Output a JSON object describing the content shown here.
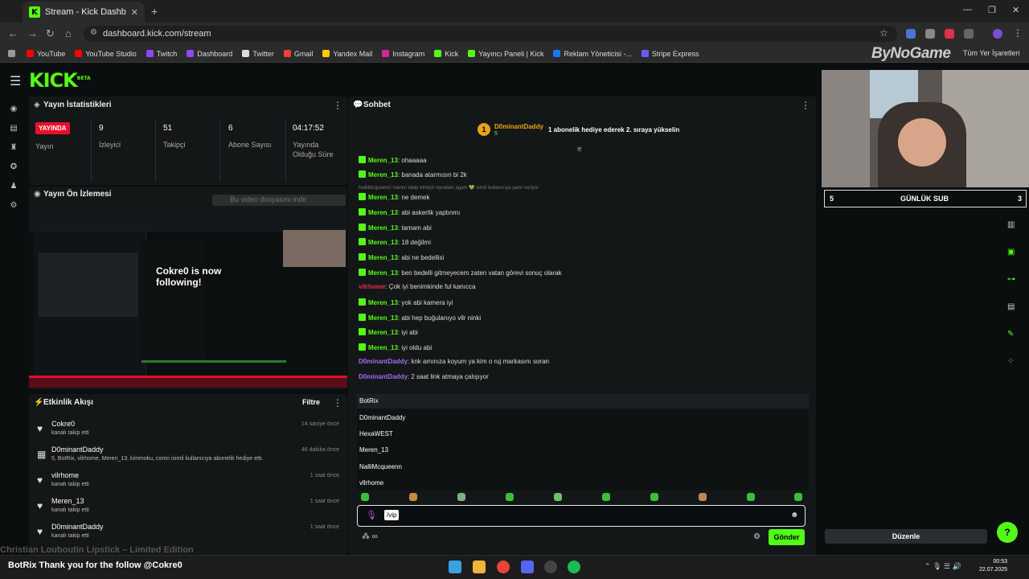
{
  "browser": {
    "tab_title": "Stream - Kick Dashboard",
    "url": "dashboard.kick.com/stream",
    "bookmarks": [
      "YouTube",
      "YouTube Studio",
      "Twitch",
      "Dashboard",
      "Twitter",
      "Gmail",
      "Yandex Mail",
      "Instagram",
      "Kick",
      "Yayıncı Paneli | Kick",
      "Reklam Yöneticisi -...",
      "Stripe Express"
    ],
    "all_bookmarks": "Tüm Yer İşaretleri",
    "overlay_brand": "ByNoGame"
  },
  "stats": {
    "title": "Yayın İstatistikleri",
    "live_badge": "YAYINDA",
    "live_label": "Yayın",
    "viewers": "9",
    "viewers_label": "İzleyici",
    "followers": "51",
    "followers_label": "Takipçi",
    "subs": "6",
    "subs_label": "Abone Sayısı",
    "duration": "04:17:52",
    "duration_label": "Yayında Olduğu Süre"
  },
  "preview": {
    "title": "Yayın Ön İzlemesi",
    "download": "Bu video dosyasını indir",
    "overlay": "Cokre0 is now following!",
    "caption": "Christian Louboutin Lipstick – Limited Edition"
  },
  "activity": {
    "title": "Etkinlik Akışı",
    "filter": "Filtre",
    "items": [
      {
        "name": "Cokre0",
        "desc": "kanalı takip etti",
        "time": "14 saniye önce"
      },
      {
        "name": "D0minantDaddy",
        "desc": "5, BotRix, vilrhome, Meren_13, kimmoku, comn isimli kullanıcıya abonelik hediye etti.",
        "time": "46 dakika önce"
      },
      {
        "name": "vilrhome",
        "desc": "kanalı takip etti",
        "time": "1 saat önce"
      },
      {
        "name": "Meren_13",
        "desc": "kanalı takip etti",
        "time": "1 saat önce"
      },
      {
        "name": "D0minantDaddy",
        "desc": "kanalı takip etti",
        "time": "1 saat önce"
      }
    ]
  },
  "chat": {
    "title": "Sohbet",
    "pinned_user": "D0minantDaddy",
    "pinned_count": "5",
    "pinned_text": "1 abonelik hediye ederek 2. sıraya yükselin",
    "reply_note": "NalliMcqueenn: meren takip etmişin eyvallah agam 💚 isimli kullanıcıya yanıt veriyor",
    "messages": [
      {
        "user": "Meren_13",
        "text": "ohaaaaa",
        "style": "u"
      },
      {
        "user": "Meren_13",
        "text": "banada atarmısın bi 2k",
        "style": "u"
      },
      {
        "user": "Meren_13",
        "text": "ne demek",
        "style": "u"
      },
      {
        "user": "Meren_13",
        "text": "abi askerlik yaptınmı",
        "style": "u"
      },
      {
        "user": "Meren_13",
        "text": "tamam abi",
        "style": "u"
      },
      {
        "user": "Meren_13",
        "text": "18 değilmi",
        "style": "u"
      },
      {
        "user": "Meren_13",
        "text": "abi ne bedellisi",
        "style": "u"
      },
      {
        "user": "Meren_13",
        "text": "ben bedelli gitmeyecem zaten vatan görevi sonuç olarak",
        "style": "u"
      },
      {
        "user": "vilrhome",
        "text": "Çok iyi benimkinde ful kanıcca",
        "style": "ur"
      },
      {
        "user": "Meren_13",
        "text": "yok abi kamera iyi",
        "style": "u"
      },
      {
        "user": "Meren_13",
        "text": "abi hep buğulanıyo vllr ninki",
        "style": "u"
      },
      {
        "user": "Meren_13",
        "text": "iyi abi",
        "style": "u"
      },
      {
        "user": "Meren_13",
        "text": "iyi oldu abi",
        "style": "u"
      },
      {
        "user": "D0minantDaddy",
        "text": "knk amınıza koyum ya kim o ruj markasını soran",
        "style": "up"
      },
      {
        "user": "D0minantDaddy",
        "text": "2 saat link atmaya çalışıyor",
        "style": "up"
      }
    ],
    "suggestions": [
      "BotRix",
      "D0minantDaddy",
      "HexaWEST",
      "Meren_13",
      "NalliMcqueenn",
      "vllrhome"
    ],
    "input_value": "/vip",
    "send": "Gönder"
  },
  "overlay": {
    "sub_left": "5",
    "sub_title": "GÜNLÜK SUB",
    "sub_right": "3",
    "edit": "Düzenle"
  },
  "taskbar": {
    "ticker": "BotRix  Thank you for the follow @Cokre0",
    "ticker_bg": "Christian Louboutin Lipstick – Limited Edition",
    "time": "00:53",
    "date": "22.07.2025"
  }
}
